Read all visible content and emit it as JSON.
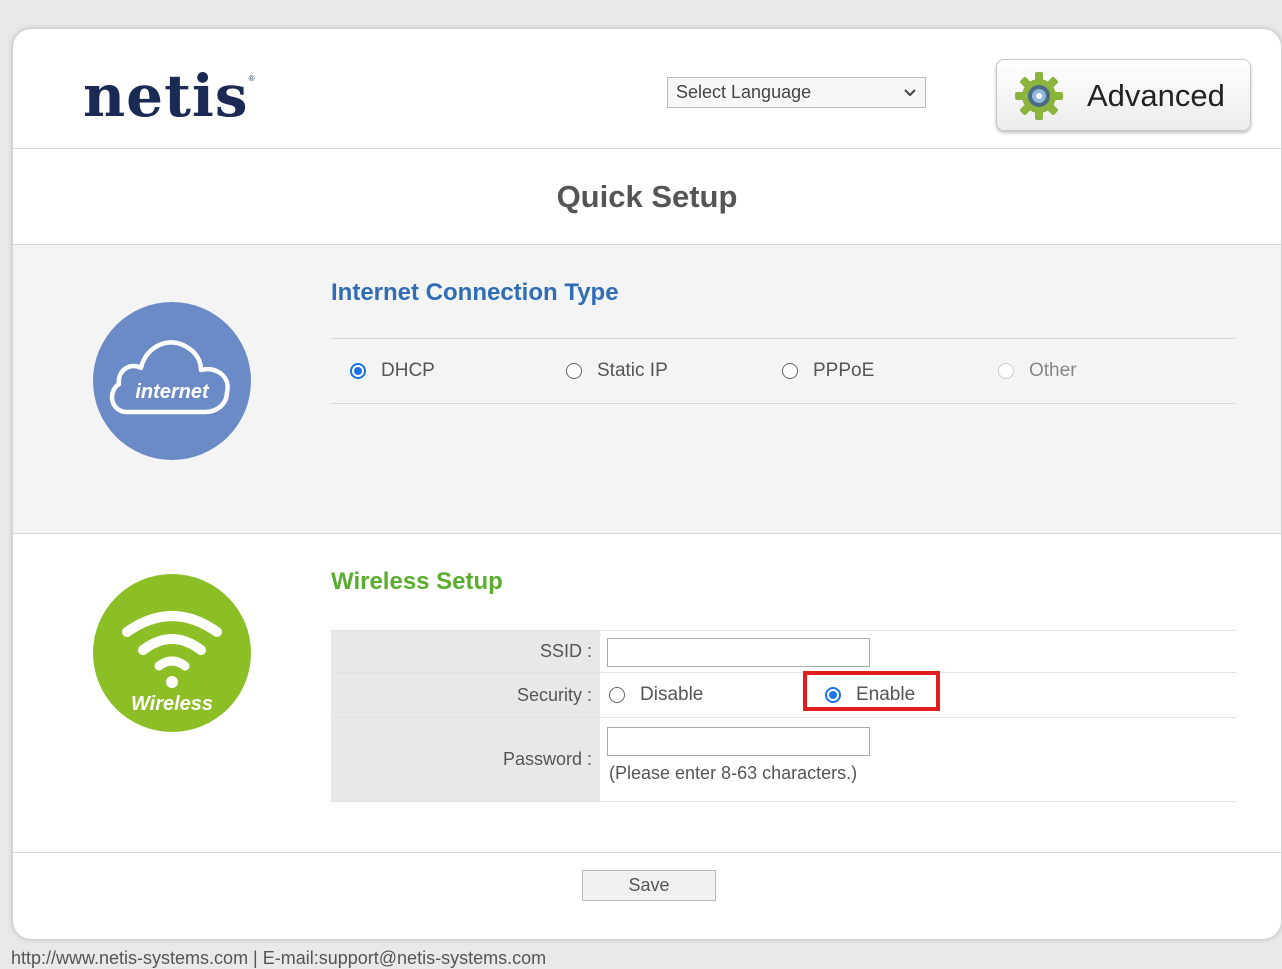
{
  "header": {
    "logo_text": "netis",
    "logo_mark": "®",
    "language_select": {
      "value": "Select Language"
    },
    "advanced_label": "Advanced"
  },
  "page": {
    "title": "Quick Setup"
  },
  "internet": {
    "icon_label": "internet",
    "title": "Internet Connection Type",
    "options": [
      {
        "label": "DHCP",
        "checked": true
      },
      {
        "label": "Static IP",
        "checked": false
      },
      {
        "label": "PPPoE",
        "checked": false
      },
      {
        "label": "Other",
        "checked": false,
        "disabled": true
      }
    ]
  },
  "wireless": {
    "icon_label": "Wireless",
    "title": "Wireless Setup",
    "ssid_label": "SSID :",
    "ssid_value": "",
    "security_label": "Security :",
    "security_options": [
      {
        "label": "Disable",
        "checked": false
      },
      {
        "label": "Enable",
        "checked": true
      }
    ],
    "password_label": "Password :",
    "password_value": "",
    "password_hint": "(Please enter 8-63 characters.)"
  },
  "actions": {
    "save_label": "Save"
  },
  "footer": {
    "text": "http://www.netis-systems.com | E-mail:support@netis-systems.com"
  },
  "colors": {
    "brand_navy": "#1b2a55",
    "internet_blue": "#6b8bc6",
    "internet_title": "#2f6db5",
    "wireless_green": "#8cbf26",
    "wireless_title": "#5aae2e",
    "highlight_red": "#e21d1d",
    "radio_blue": "#1a73e8"
  },
  "icons": {
    "advanced": "gear-icon",
    "internet": "cloud-icon",
    "wireless": "wifi-icon",
    "dropdown": "chevron-down-icon"
  }
}
